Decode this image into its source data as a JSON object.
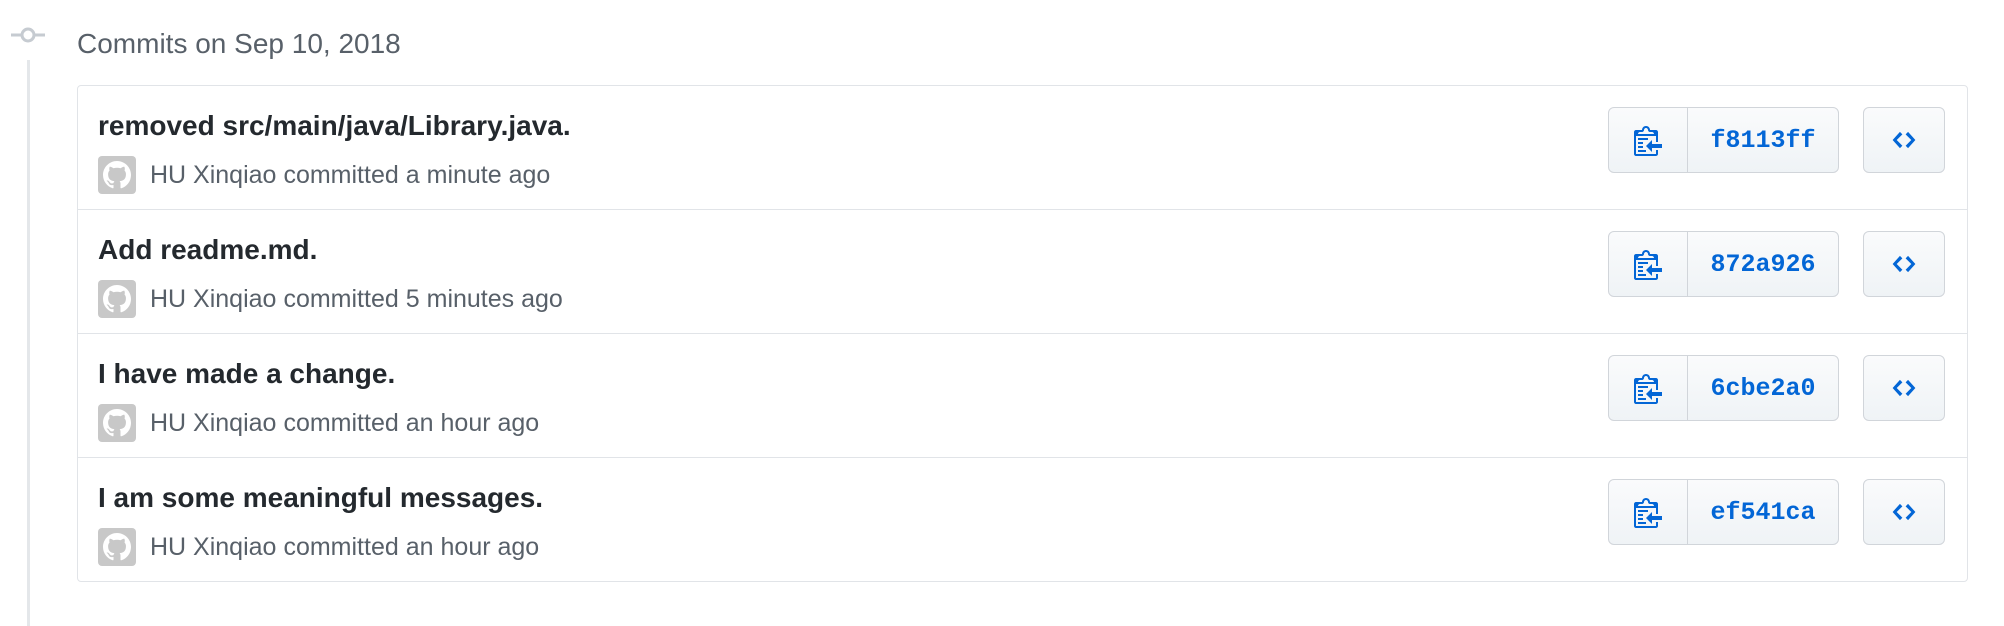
{
  "group": {
    "title": "Commits on Sep 10, 2018"
  },
  "colors": {
    "link": "#0366d6",
    "muted": "#586069",
    "border": "#e1e4e8"
  },
  "commits": [
    {
      "message": "removed src/main/java/Library.java.",
      "author": "HU Xinqiao",
      "verb": "committed",
      "time": "a minute ago",
      "sha": "f8113ff"
    },
    {
      "message": "Add readme.md.",
      "author": "HU Xinqiao",
      "verb": "committed",
      "time": "5 minutes ago",
      "sha": "872a926"
    },
    {
      "message": "I have made a change.",
      "author": "HU Xinqiao",
      "verb": "committed",
      "time": "an hour ago",
      "sha": "6cbe2a0"
    },
    {
      "message": "I am some meaningful messages.",
      "author": "HU Xinqiao",
      "verb": "committed",
      "time": "an hour ago",
      "sha": "ef541ca"
    }
  ],
  "icons": {
    "timeline": "git-commit-icon",
    "avatar": "github-octocat-icon",
    "copy": "clippy-icon",
    "browse": "code-icon"
  }
}
